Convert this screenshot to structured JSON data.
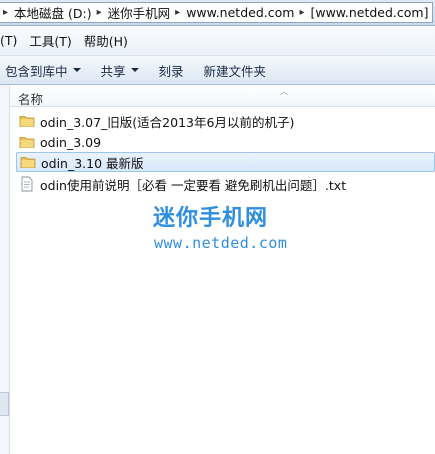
{
  "address_bar": {
    "crumbs": [
      "本地磁盘 (D:)",
      "迷你手机网",
      "www.netded.com",
      "[www.netded.com]"
    ]
  },
  "menu": {
    "items": [
      "(T)",
      "工具(T)",
      "帮助(H)"
    ]
  },
  "toolbar": {
    "include_library": "包含到库中",
    "share": "共享",
    "burn": "刻录",
    "new_folder": "新建文件夹"
  },
  "file_list": {
    "column_name": "名称",
    "items": [
      {
        "label": "odin_3.07_旧版(适合2013年6月以前的机子)",
        "type": "folder",
        "selected": false
      },
      {
        "label": "odin_3.09",
        "type": "folder",
        "selected": false
      },
      {
        "label": "odin_3.10 最新版",
        "type": "folder",
        "selected": true
      },
      {
        "label": "odin使用前说明［必看 一定要看 避免刷机出问题］.txt",
        "type": "text-file",
        "selected": false
      }
    ]
  },
  "watermark": {
    "title": "迷你手机网",
    "url": "www.netded.com"
  },
  "colors": {
    "watermark": "#2f8ee0",
    "selection": "#d6e8fb",
    "folder": "#e8c25a"
  },
  "icons": {
    "folder": "folder-icon",
    "text_file": "text-file-icon",
    "dropdown": "chevron-down-icon"
  }
}
